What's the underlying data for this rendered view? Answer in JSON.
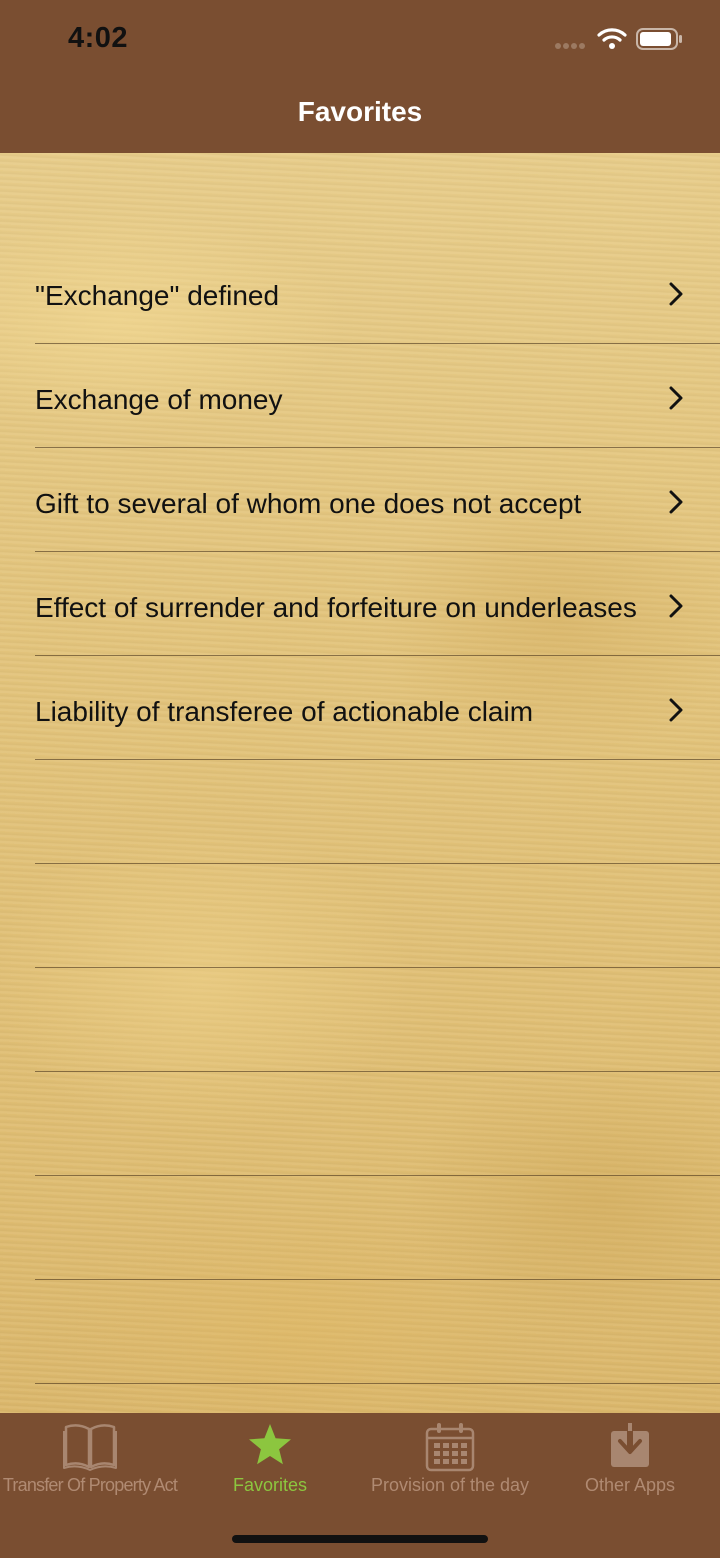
{
  "status_bar": {
    "time": "4:02"
  },
  "nav": {
    "title": "Favorites"
  },
  "favorites": [
    {
      "label": "\"Exchange\" defined"
    },
    {
      "label": "Exchange of money"
    },
    {
      "label": "Gift to several of whom one does not accept"
    },
    {
      "label": "Effect of surrender and forfeiture on underleases"
    },
    {
      "label": "Liability of transferee of actionable claim"
    }
  ],
  "tabbar": {
    "tabs": [
      {
        "label": "Transfer Of Property Act",
        "icon": "book-icon",
        "active": false
      },
      {
        "label": "Favorites",
        "icon": "star-icon",
        "active": true
      },
      {
        "label": "Provision of the day",
        "icon": "calendar-icon",
        "active": false
      },
      {
        "label": "Other Apps",
        "icon": "download-icon",
        "active": false
      }
    ]
  },
  "colors": {
    "header": "#7a4e31",
    "tab_active": "#8cc63f",
    "tab_inactive": "#b08a72",
    "parchment": "#e2c47e"
  }
}
